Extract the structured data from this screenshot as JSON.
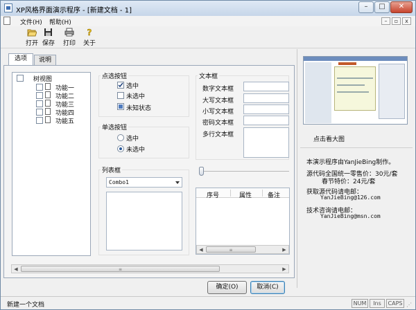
{
  "window": {
    "title": "XP风格界面演示程序 - [新建文档 - 1]"
  },
  "caption_buttons": {
    "minimize": "–",
    "maximize": "□",
    "close": "✕"
  },
  "mdi_buttons": {
    "minimize": "–",
    "restore": "▫",
    "close": "x"
  },
  "menu": [
    "文件(H)",
    "帮助(H)"
  ],
  "toolbar": [
    {
      "label": "打开",
      "icon": "folder-open-icon"
    },
    {
      "label": "保存",
      "icon": "floppy-save-icon"
    },
    {
      "label": "打印",
      "icon": "printer-icon"
    },
    {
      "label": "关于",
      "icon": "question-help-icon"
    }
  ],
  "tabs": [
    "选项",
    "说明"
  ],
  "tree": {
    "root": "树视图",
    "children": [
      "功能一",
      "功能二",
      "功能三",
      "功能四",
      "功能五"
    ]
  },
  "checkbox_group": {
    "title": "点选按钮",
    "items": [
      {
        "label": "选中",
        "state": "checked"
      },
      {
        "label": "未选中",
        "state": "unchecked"
      },
      {
        "label": "未知状态",
        "state": "indeterminate"
      }
    ]
  },
  "radio_group": {
    "title": "单选按钮",
    "items": [
      {
        "label": "选中",
        "selected": false
      },
      {
        "label": "未选中",
        "selected": true
      }
    ]
  },
  "textbox_group": {
    "title": "文本框",
    "fields": [
      "数字文本框",
      "大写文本框",
      "小写文本框",
      "密码文本框",
      "多行文本框"
    ]
  },
  "listbox_group": {
    "title": "列表框",
    "combo_value": "Combo1"
  },
  "slider": {
    "value": 0
  },
  "list_view": {
    "columns": [
      "序号",
      "属性",
      "备注"
    ]
  },
  "buttons": {
    "ok": "确定(O)",
    "cancel": "取消(C)"
  },
  "preview": {
    "caption": "点击看大图"
  },
  "info": {
    "line1": "本演示程序由YanJieBing制作。",
    "line2": "源代码全国统一零售价：30元/套",
    "line3": "春节特价：24元/套",
    "line4": "获取源代码请电邮：",
    "email1": "YanJieBing@126.com",
    "line5": "技术咨询请电邮：",
    "email2": "YanJieBing@msn.com"
  },
  "status": {
    "text": "新建一个文档",
    "indicators": [
      "NUM",
      "Ins",
      "CAPS"
    ]
  }
}
